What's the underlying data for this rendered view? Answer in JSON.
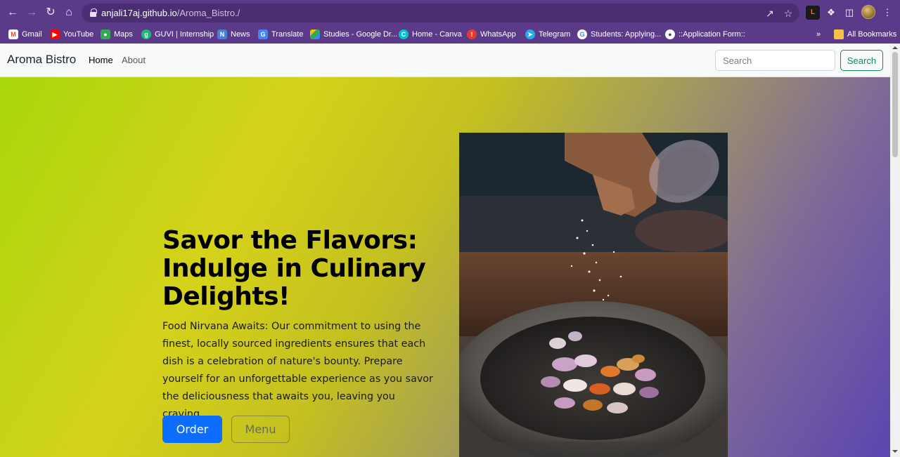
{
  "browser": {
    "url_host": "anjali17aj.github.io",
    "url_path": "/Aroma_Bistro./",
    "colors": {
      "chrome": "#5b3a8a",
      "omnibox": "#4a2d73"
    },
    "bookmarks": [
      {
        "label": "Gmail",
        "icon": "gmail-icon"
      },
      {
        "label": "YouTube",
        "icon": "youtube-icon"
      },
      {
        "label": "Maps",
        "icon": "maps-icon"
      },
      {
        "label": "GUVI | Internship",
        "icon": "guvi-icon"
      },
      {
        "label": "News",
        "icon": "news-icon"
      },
      {
        "label": "Translate",
        "icon": "translate-icon"
      },
      {
        "label": "Studies - Google Dr...",
        "icon": "google-drive-icon"
      },
      {
        "label": "Home - Canva",
        "icon": "canva-icon"
      },
      {
        "label": "WhatsApp",
        "icon": "whatsapp-icon"
      },
      {
        "label": "Telegram",
        "icon": "telegram-icon"
      },
      {
        "label": "Students: Applying...",
        "icon": "google-icon"
      },
      {
        "label": "::Application Form::",
        "icon": "globe-icon"
      }
    ],
    "all_bookmarks_label": "All Bookmarks"
  },
  "navbar": {
    "brand": "Aroma Bistro",
    "links": [
      "Home",
      "About"
    ],
    "search_placeholder": "Search",
    "search_button": "Search"
  },
  "hero": {
    "title": "Savor the Flavors: Indulge in Culinary Delights!",
    "text": "Food Nirvana Awaits: Our commitment to using the finest, locally sourced ingredients ensures that each dish is a celebration of nature's bounty. Prepare yourself for an unforgettable experience as you savor the deliciousness that awaits you, leaving you craving.",
    "order_button": "Order",
    "menu_button": "Menu",
    "image": "seasoning-mortar-photo",
    "colors": {
      "primary": "#0d6efd",
      "success": "#198754"
    }
  }
}
